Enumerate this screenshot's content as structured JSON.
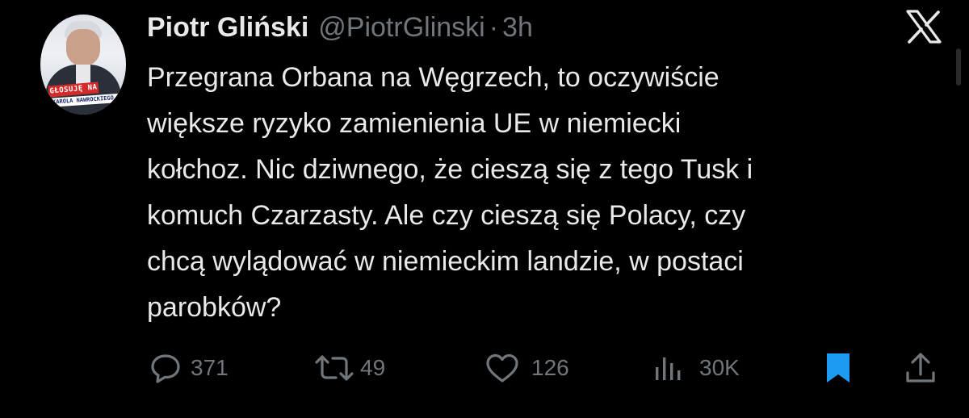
{
  "tweet": {
    "author": {
      "name": "Piotr Gliński",
      "handle": "@PiotrGlinski",
      "separator": "·",
      "time": "3h",
      "avatar_badge_line1": "GŁOSUJĘ NA",
      "avatar_badge_line2": "KAROLA NAWROCKIEGO"
    },
    "text_lines": [
      "Przegrana Orbana na Węgrzech, to oczywiście",
      "większe ryzyko zamienienia UE w niemiecki",
      "kołchoz. Nic dziwnego, że cieszą się z tego Tusk i",
      "komuch Czarzasty. Ale czy cieszą się Polacy, czy",
      "chcą wylądować w niemieckim landzie, w postaci",
      "parobków?"
    ],
    "stats": {
      "replies": "371",
      "reposts": "49",
      "likes": "126",
      "views": "30K"
    },
    "icons": {
      "logo": "x-logo-icon",
      "reply": "reply-icon",
      "repost": "repost-icon",
      "like": "heart-icon",
      "views": "views-icon",
      "bookmark": "bookmark-icon",
      "share": "share-icon"
    }
  },
  "colors": {
    "background": "#000000",
    "text": "#e7e9ea",
    "secondary": "#71767b",
    "bookmark_accent": "#1d9bf0"
  }
}
